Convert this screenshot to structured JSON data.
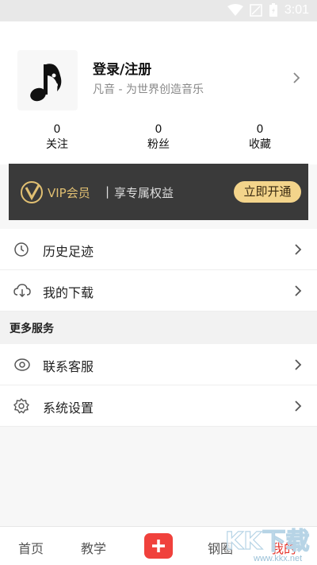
{
  "status": {
    "time": "3:01"
  },
  "profile": {
    "title": "登录/注册",
    "subtitle": "凡音 - 为世界创造音乐",
    "stats": [
      {
        "value": "0",
        "label": "关注"
      },
      {
        "value": "0",
        "label": "粉丝"
      },
      {
        "value": "0",
        "label": "收藏"
      }
    ]
  },
  "vip": {
    "title": "VIP会员",
    "separator": "|",
    "desc": "享专属权益",
    "button": "立即开通",
    "colors": {
      "bg": "#3a3a3a",
      "gold": "#e0bf72",
      "button": "#f3d48b"
    }
  },
  "menu": {
    "history": "历史足迹",
    "downloads": "我的下载"
  },
  "services": {
    "header": "更多服务",
    "contact": "联系客服",
    "settings": "系统设置"
  },
  "tabs": {
    "home": "首页",
    "teach": "教学",
    "circle": "钢圈",
    "mine": "我的"
  },
  "watermark": {
    "main": "KK下载",
    "sub": "www.kkx.net"
  },
  "accent": "#e5332a"
}
